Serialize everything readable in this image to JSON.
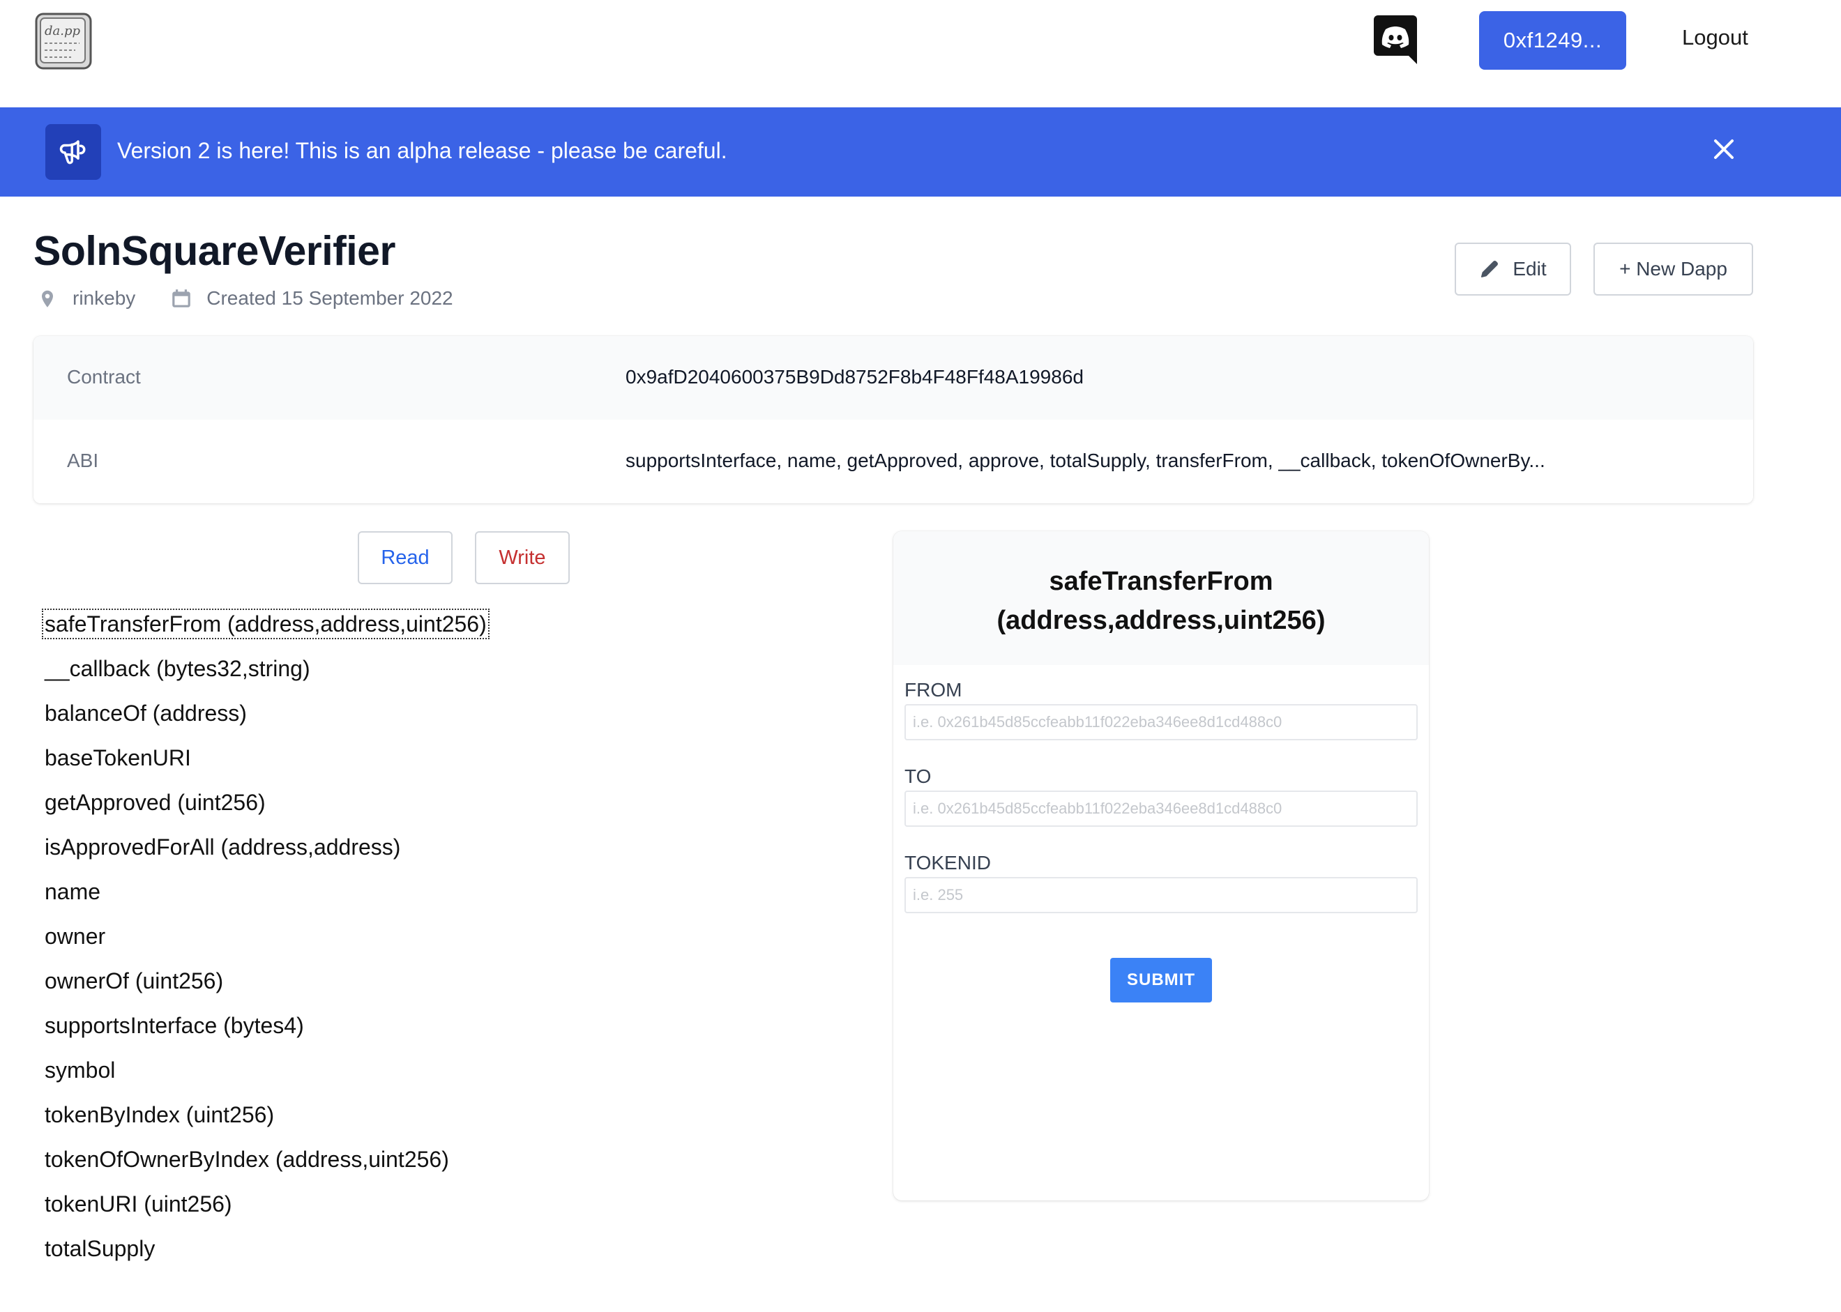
{
  "header": {
    "logo_icon": "dapp-logo-icon",
    "discord_icon": "discord-icon",
    "wallet_label": "0xf1249...",
    "logout_label": "Logout"
  },
  "banner": {
    "icon": "megaphone-icon",
    "message": "Version 2 is here! This is an alpha release - please be careful.",
    "close_icon": "close-icon",
    "color": "#3b63e6"
  },
  "dapp": {
    "title": "SolnSquareVerifier",
    "network": "rinkeby",
    "created": "Created 15 September 2022",
    "edit_label": "Edit",
    "new_dapp_label": "+ New Dapp"
  },
  "info": {
    "contract_label": "Contract",
    "contract_value": "0x9afD2040600375B9Dd8752F8b4F48Ff48A19986d",
    "abi_label": "ABI",
    "abi_value": "supportsInterface, name, getApproved, approve, totalSupply, transferFrom, __callback, tokenOfOwnerBy..."
  },
  "tabs": {
    "read_label": "Read",
    "write_label": "Write"
  },
  "functions": [
    "safeTransferFrom (address,address,uint256)",
    "__callback (bytes32,string)",
    "balanceOf (address)",
    "baseTokenURI",
    "getApproved (uint256)",
    "isApprovedForAll (address,address)",
    "name",
    "owner",
    "ownerOf (uint256)",
    "supportsInterface (bytes4)",
    "symbol",
    "tokenByIndex (uint256)",
    "tokenOfOwnerByIndex (address,uint256)",
    "tokenURI (uint256)",
    "totalSupply"
  ],
  "panel": {
    "title_line1": "safeTransferFrom",
    "title_line2": "(address,address,uint256)",
    "fields": [
      {
        "label": "FROM",
        "placeholder": "i.e. 0x261b45d85ccfeabb11f022eba346ee8d1cd488c0",
        "value": ""
      },
      {
        "label": "TO",
        "placeholder": "i.e. 0x261b45d85ccfeabb11f022eba346ee8d1cd488c0",
        "value": ""
      },
      {
        "label": "TOKENID",
        "placeholder": "i.e. 255",
        "value": ""
      }
    ],
    "submit_label": "SUBMIT"
  }
}
